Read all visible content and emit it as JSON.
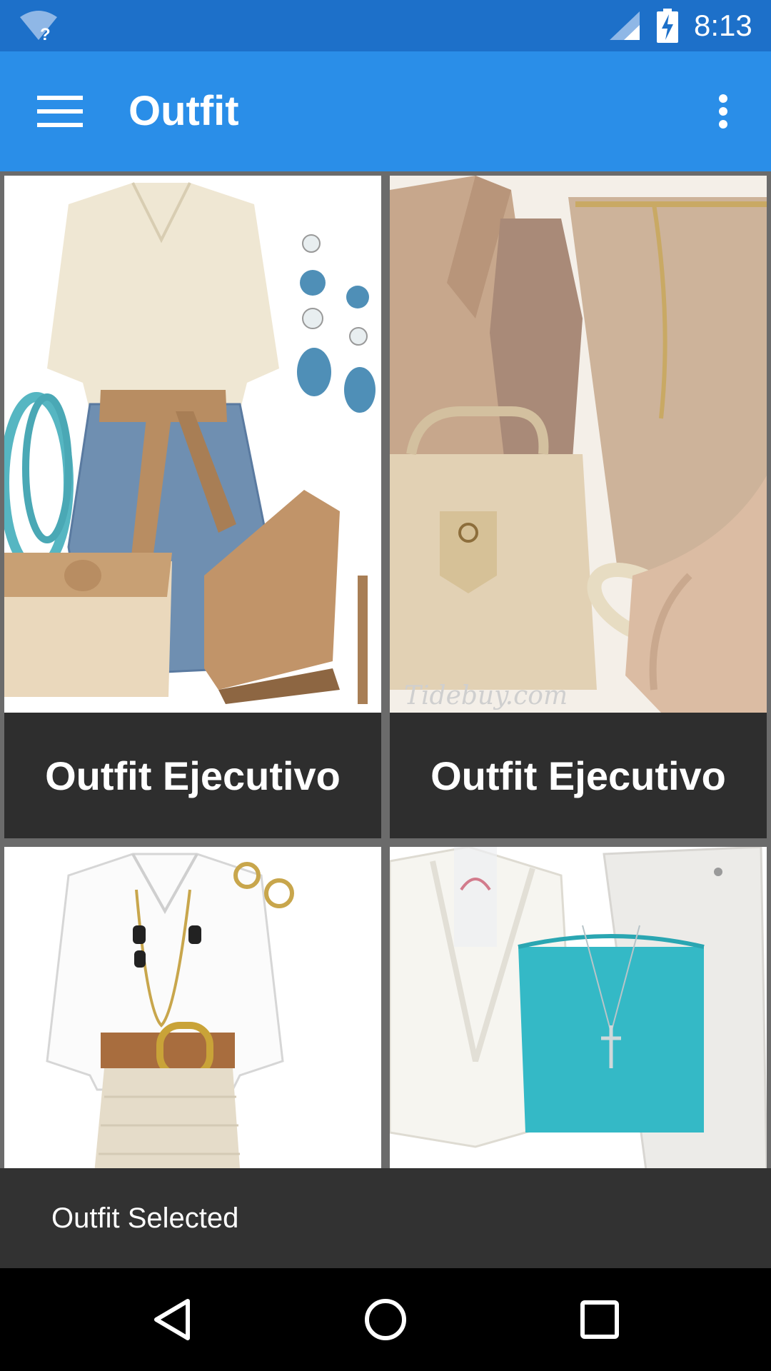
{
  "status_bar": {
    "time": "8:13",
    "icons": [
      "wifi-unknown-icon",
      "cell-signal-icon",
      "battery-charging-icon"
    ]
  },
  "app_bar": {
    "title": "Outfit",
    "icons": [
      "hamburger-menu-icon",
      "overflow-menu-icon"
    ]
  },
  "grid": {
    "cards": [
      {
        "label": "Outfit Ejecutivo",
        "image": "outfit-blouse-skirt-sandals-photo"
      },
      {
        "label": "Outfit Ejecutivo",
        "image": "outfit-beige-blazer-bag-photo",
        "watermark": "Tidebuy.com"
      },
      {
        "label": "",
        "image": "outfit-white-shirt-belt-photo"
      },
      {
        "label": "",
        "image": "outfit-white-jacket-teal-top-photo"
      }
    ]
  },
  "snackbar": {
    "text": "Outfit Selected"
  },
  "nav_bar": {
    "icons": [
      "back-icon",
      "home-icon",
      "recents-icon"
    ]
  },
  "colors": {
    "status_bar": "#1d70c9",
    "app_bar": "#2a8ee8",
    "card_label_bg": "#2e2e2e",
    "snackbar_bg": "#323232",
    "grid_bg": "#6b6b6b"
  }
}
